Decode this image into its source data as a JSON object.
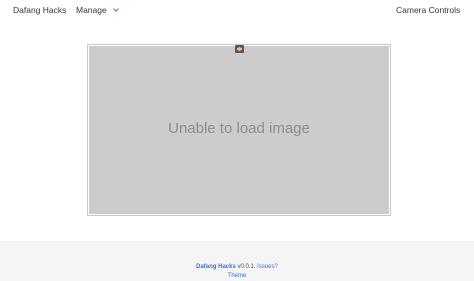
{
  "navbar": {
    "brand": "Dafang Hacks",
    "manage_label": "Manage",
    "camera_controls_label": "Camera Controls"
  },
  "image": {
    "alt_text": "Unable to load image"
  },
  "footer": {
    "project_name": "Dafang Hacks",
    "version": " v0.0.1.",
    "issues_link": "Issues?",
    "theme_link": "Theme"
  },
  "colors": {
    "link": "#3273dc",
    "footer_bg": "#f5f5f5",
    "image_placeholder": "#cccccc"
  },
  "icons": {
    "badge": "settings-badge-icon",
    "manage_dropdown": "chevron-down-icon"
  }
}
